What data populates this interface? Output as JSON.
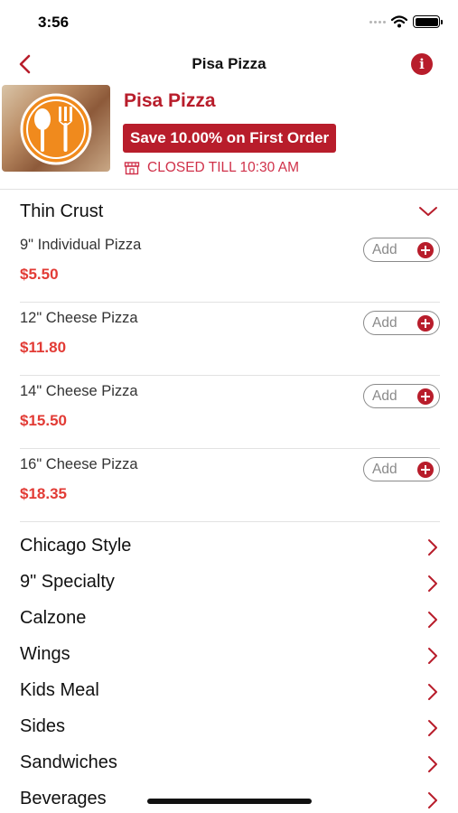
{
  "status_bar": {
    "time": "3:56"
  },
  "nav": {
    "title": "Pisa Pizza",
    "info_glyph": "i"
  },
  "restaurant": {
    "name": "Pisa Pizza",
    "promo": "Save 10.00% on First Order",
    "status": "CLOSED TILL 10:30 AM"
  },
  "section": {
    "title": "Thin Crust",
    "items": [
      {
        "name": "9\" Individual Pizza",
        "price": "$5.50",
        "add_label": "Add"
      },
      {
        "name": "12\" Cheese Pizza",
        "price": "$11.80",
        "add_label": "Add"
      },
      {
        "name": "14\" Cheese Pizza",
        "price": "$15.50",
        "add_label": "Add"
      },
      {
        "name": "16\" Cheese Pizza",
        "price": "$18.35",
        "add_label": "Add"
      }
    ]
  },
  "categories": [
    {
      "label": "Chicago Style"
    },
    {
      "label": "9\" Specialty"
    },
    {
      "label": "Calzone"
    },
    {
      "label": "Wings"
    },
    {
      "label": "Kids Meal"
    },
    {
      "label": "Sides"
    },
    {
      "label": "Sandwiches"
    },
    {
      "label": "Beverages"
    }
  ],
  "colors": {
    "brand": "#b81d2b",
    "price": "#e23b35",
    "logo_orange": "#f08a1d"
  },
  "icons": [
    "back-chevron-icon",
    "info-icon",
    "restaurant-logo-icon",
    "store-icon",
    "chevron-down-icon",
    "plus-icon",
    "chevron-right-icon"
  ]
}
